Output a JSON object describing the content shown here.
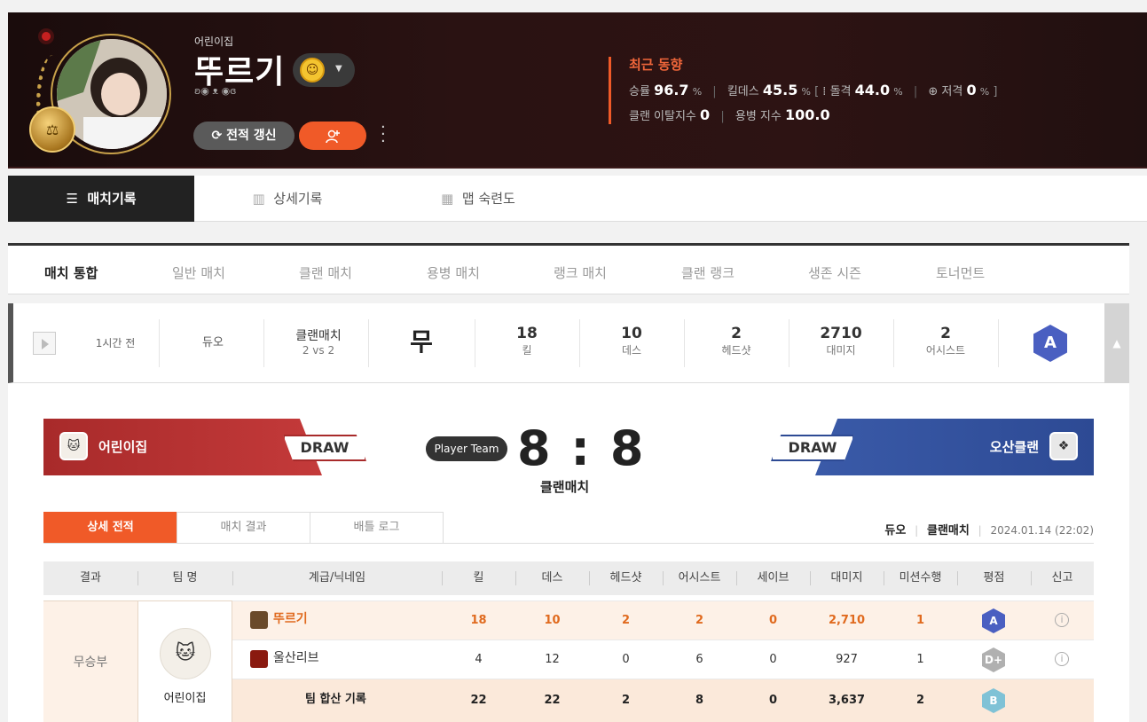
{
  "profile": {
    "clan": "어린이집",
    "nickname": "뚜르기",
    "refresh_label": "전적 갱신",
    "add_icon": "user-plus-icon",
    "rank_badge": "⚖",
    "trend": {
      "title": "최근 동향",
      "winrate_label": "승률",
      "winrate": "96.7",
      "kd_label": "킬데스",
      "kd": "45.5",
      "assault_label": "돌격",
      "assault": "44.0",
      "sniper_label": "저격",
      "sniper": "0",
      "percent": "%",
      "leave_label": "클랜 이탈지수",
      "leave": "0",
      "merc_label": "용병 지수",
      "merc": "100.0"
    }
  },
  "main_tabs": [
    {
      "label": "매치기록"
    },
    {
      "label": "상세기록"
    },
    {
      "label": "맵 숙련도"
    }
  ],
  "filter_tabs": [
    {
      "label": "매치 통합"
    },
    {
      "label": "일반 매치"
    },
    {
      "label": "클랜 매치"
    },
    {
      "label": "용병 매치"
    },
    {
      "label": "랭크 매치"
    },
    {
      "label": "클랜 랭크"
    },
    {
      "label": "생존 시즌"
    },
    {
      "label": "토너먼트"
    }
  ],
  "match": {
    "time": "1시간 전",
    "mode": "듀오",
    "type": "클랜매치",
    "format": "2 vs 2",
    "result": "무",
    "kills": "18",
    "kills_label": "킬",
    "deaths": "10",
    "deaths_label": "데스",
    "headshots": "2",
    "headshots_label": "헤드샷",
    "damage": "2710",
    "damage_label": "대미지",
    "assists": "2",
    "assists_label": "어시스트",
    "grade": "A"
  },
  "detail": {
    "left_team": "어린이집",
    "right_team": "오산클랜",
    "draw_label": "DRAW",
    "player_team_label": "Player Team",
    "score_left": "8",
    "score_right": "8",
    "score_sep": ":",
    "score_sub": "클랜매치",
    "tabs": [
      {
        "label": "상세 전적"
      },
      {
        "label": "매치 결과"
      },
      {
        "label": "배틀 로그"
      }
    ],
    "meta_mode": "듀오",
    "meta_type": "클랜매치",
    "meta_date": "2024.01.14 (22:02)"
  },
  "table": {
    "headers": [
      "결과",
      "팀 명",
      "계급/닉네임",
      "킬",
      "데스",
      "헤드샷",
      "어시스트",
      "세이브",
      "대미지",
      "미션수행",
      "평점",
      "신고"
    ],
    "result": "무승부",
    "team": "어린이집",
    "rows": [
      {
        "name": "뚜르기",
        "kills": "18",
        "deaths": "10",
        "hs": "2",
        "assists": "2",
        "saves": "0",
        "damage": "2,710",
        "missions": "1",
        "grade": "A"
      },
      {
        "name": "울산리브",
        "kills": "4",
        "deaths": "12",
        "hs": "0",
        "assists": "6",
        "saves": "0",
        "damage": "927",
        "missions": "1",
        "grade": "D+"
      }
    ],
    "total": {
      "label": "팀 합산 기록",
      "kills": "22",
      "deaths": "22",
      "hs": "2",
      "assists": "8",
      "saves": "0",
      "damage": "3,637",
      "missions": "2",
      "grade": "B"
    }
  },
  "colors": {
    "accent": "#f05a28",
    "red_team": "#a82a2a",
    "blue_team": "#2d4a94",
    "grade_a": "#4a5fc1",
    "grade_d": "#b0b0b0",
    "grade_b": "#7fc2d6"
  }
}
